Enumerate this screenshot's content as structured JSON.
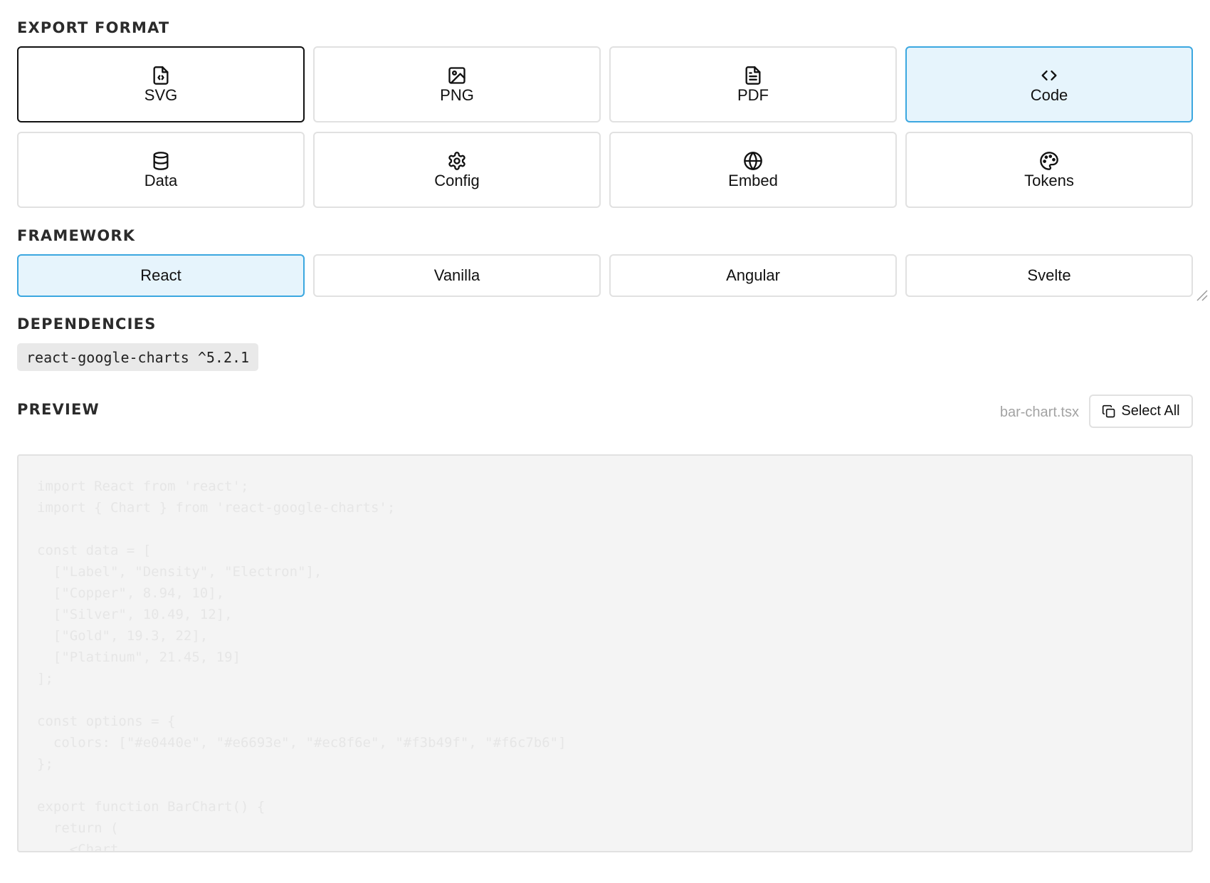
{
  "export_format": {
    "heading": "EXPORT FORMAT",
    "options": [
      {
        "label": "SVG",
        "icon": "file-code-icon"
      },
      {
        "label": "PNG",
        "icon": "image-icon"
      },
      {
        "label": "PDF",
        "icon": "file-text-icon"
      },
      {
        "label": "Code",
        "icon": "code-brackets-icon"
      },
      {
        "label": "Data",
        "icon": "database-icon"
      },
      {
        "label": "Config",
        "icon": "gear-icon"
      },
      {
        "label": "Embed",
        "icon": "globe-icon"
      },
      {
        "label": "Tokens",
        "icon": "palette-icon"
      }
    ]
  },
  "framework": {
    "heading": "FRAMEWORK",
    "options": [
      "React",
      "Vanilla",
      "Angular",
      "Svelte"
    ],
    "selected": "React"
  },
  "dependencies": {
    "heading": "DEPENDENCIES",
    "package": "react-google-charts ^5.2.1"
  },
  "preview": {
    "heading": "PREVIEW",
    "file_name": "bar-chart.tsx",
    "select_all_label": "Select All",
    "code_lines": [
      "import React from 'react';",
      "import { Chart } from 'react-google-charts';",
      "",
      "const data = [",
      "  [\"Label\", \"Density\", \"Electron\"],",
      "  [\"Copper\", 8.94, 10],",
      "  [\"Silver\", 10.49, 12],",
      "  [\"Gold\", 19.3, 22],",
      "  [\"Platinum\", 21.45, 19]",
      "];",
      "",
      "const options = {",
      "  colors: [\"#e0440e\", \"#e6693e\", \"#ec8f6e\", \"#f3b49f\", \"#f6c7b6\"]",
      "};",
      "",
      "export function BarChart() {",
      "  return (",
      "    <Chart"
    ]
  },
  "colors": {
    "accent_bg": "#e6f4fc",
    "accent_border": "#3ba7e0",
    "active_border": "#111111"
  }
}
